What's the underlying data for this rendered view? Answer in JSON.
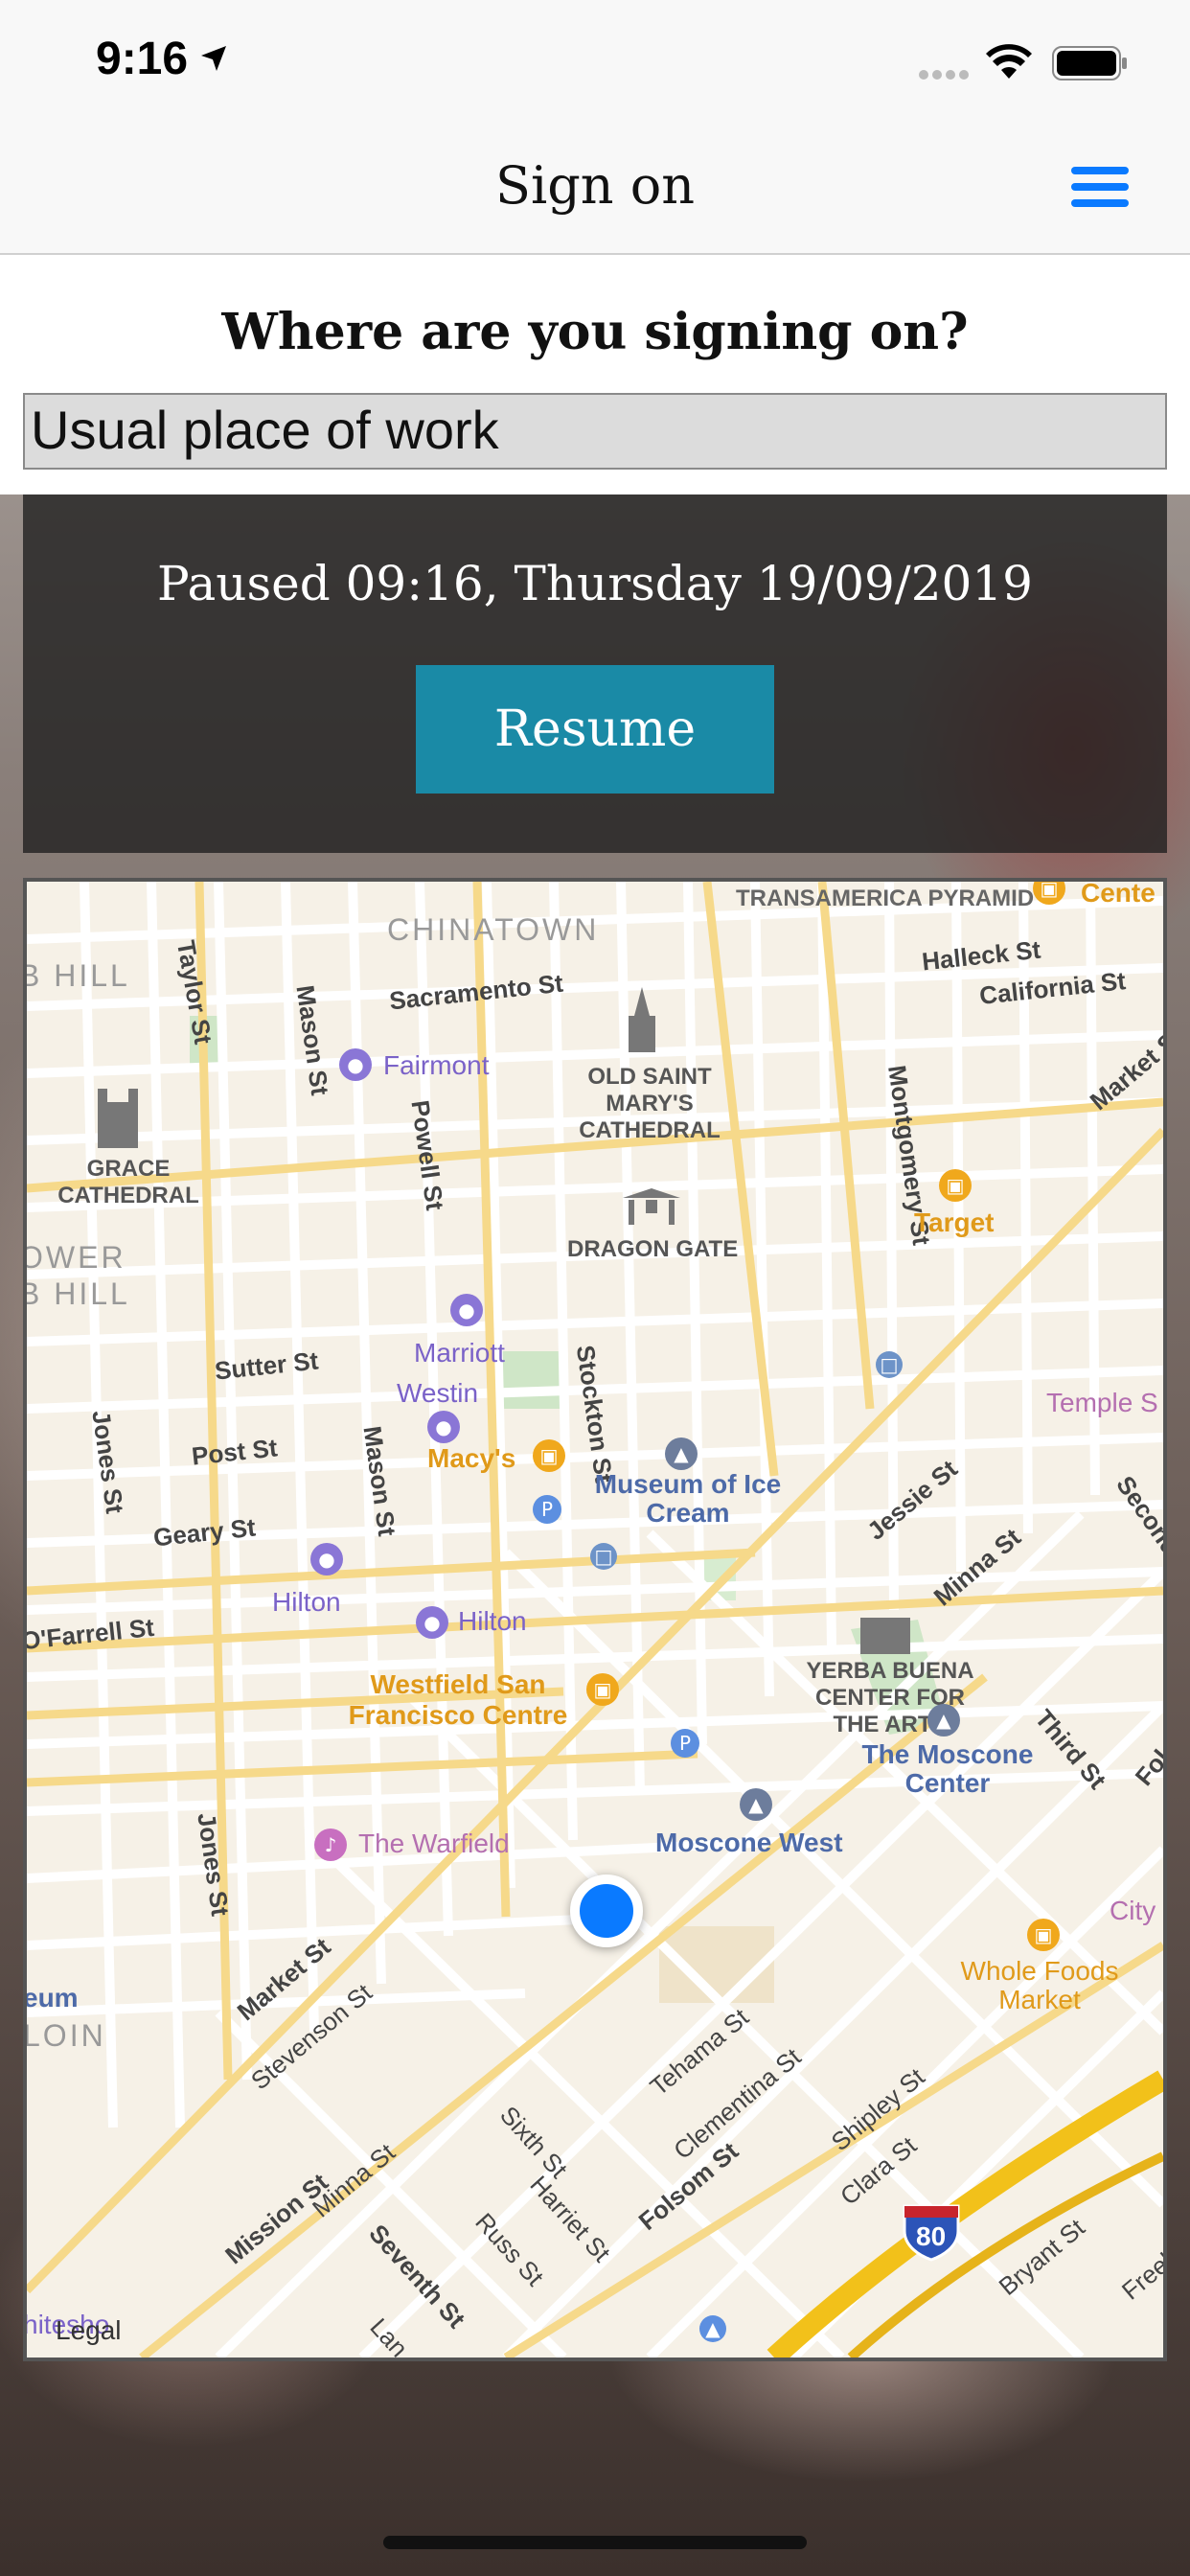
{
  "status_bar": {
    "time": "9:16"
  },
  "nav": {
    "title": "Sign on",
    "menu_icon": "hamburger-menu-icon"
  },
  "prompt": {
    "question": "Where are you signing on?",
    "location_value": "Usual place of work"
  },
  "paused": {
    "text": "Paused 09:16, Thursday 19/09/2019",
    "resume_label": "Resume"
  },
  "map": {
    "districts": [
      "CHINATOWN",
      "B HILL",
      "OWER",
      "B HILL",
      "LOIN"
    ],
    "streets": [
      "Taylor St",
      "Mason St",
      "Sacramento St",
      "Halleck St",
      "California St",
      "Market St",
      "Powell St",
      "Montgomery St",
      "Sutter St",
      "Stockton St",
      "Jones St",
      "Post St",
      "Mason St",
      "Geary St",
      "Jessie St",
      "Minna St",
      "O'Farrell St",
      "Second St",
      "Third St",
      "Folsom St",
      "Jones St",
      "Market St",
      "Stevenson St",
      "Tehama St",
      "Clementina St",
      "Shipley St",
      "Clara St",
      "Sixth St",
      "Minna St",
      "Harriet St",
      "Russ St",
      "Mission St",
      "Seventh St",
      "Folsom St",
      "Bryant St",
      "Freel",
      "Lan"
    ],
    "pois": {
      "transamerica": "TRANSAMERICA PYRAMID",
      "center": "Cente",
      "fairmont": "Fairmont",
      "old_saint_marys": "OLD SAINT MARY'S CATHEDRAL",
      "grace": "GRACE CATHEDRAL",
      "target": "Target",
      "dragon_gate": "DRAGON GATE",
      "marriott": "Marriott",
      "temple": "Temple S",
      "westin": "Westin",
      "macys": "Macy's",
      "museum": "Museum of Ice Cream",
      "yerba_buena": "YERBA BUENA CENTER FOR THE ARTS",
      "hilton1": "Hilton",
      "hilton2": "Hilton",
      "westfield": "Westfield San Francisco Centre",
      "moscone_center": "The Moscone Center",
      "warfield": "The Warfield",
      "moscone_west": "Moscone West",
      "city": "City",
      "whole_foods": "Whole Foods Market",
      "eum": "eum",
      "hitesho": "hitesho",
      "interstate": "80"
    },
    "legal": "Legal"
  }
}
